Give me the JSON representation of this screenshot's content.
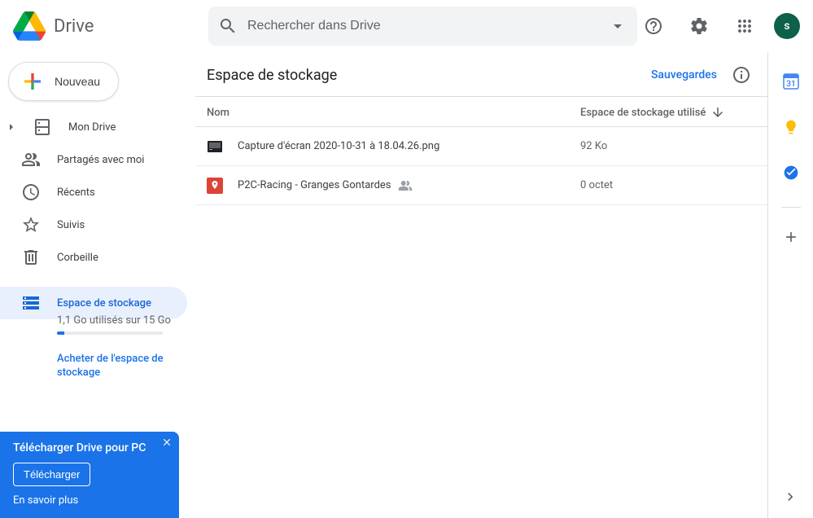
{
  "header": {
    "product_name": "Drive",
    "search_placeholder": "Rechercher dans Drive",
    "avatar_letter": "s"
  },
  "sidebar": {
    "new_button": "Nouveau",
    "items": [
      {
        "label": "Mon Drive"
      },
      {
        "label": "Partagés avec moi"
      },
      {
        "label": "Récents"
      },
      {
        "label": "Suivis"
      },
      {
        "label": "Corbeille"
      },
      {
        "label": "Espace de stockage"
      }
    ],
    "storage_text": "1,1 Go utilisés sur 15 Go",
    "buy_storage": "Acheter de l'espace de stockage"
  },
  "promo": {
    "title": "Télécharger Drive pour PC",
    "button": "Télécharger",
    "more": "En savoir plus"
  },
  "page": {
    "title": "Espace de stockage",
    "backups": "Sauvegardes",
    "col_name": "Nom",
    "col_storage": "Espace de stockage utilisé"
  },
  "files": [
    {
      "name": "Capture d'écran 2020-10-31 à 18.04.26.png",
      "size": "92 Ko",
      "shared": false,
      "type": "image"
    },
    {
      "name": "P2C-Racing - Granges Gontardes",
      "size": "0 octet",
      "shared": true,
      "type": "map"
    }
  ]
}
